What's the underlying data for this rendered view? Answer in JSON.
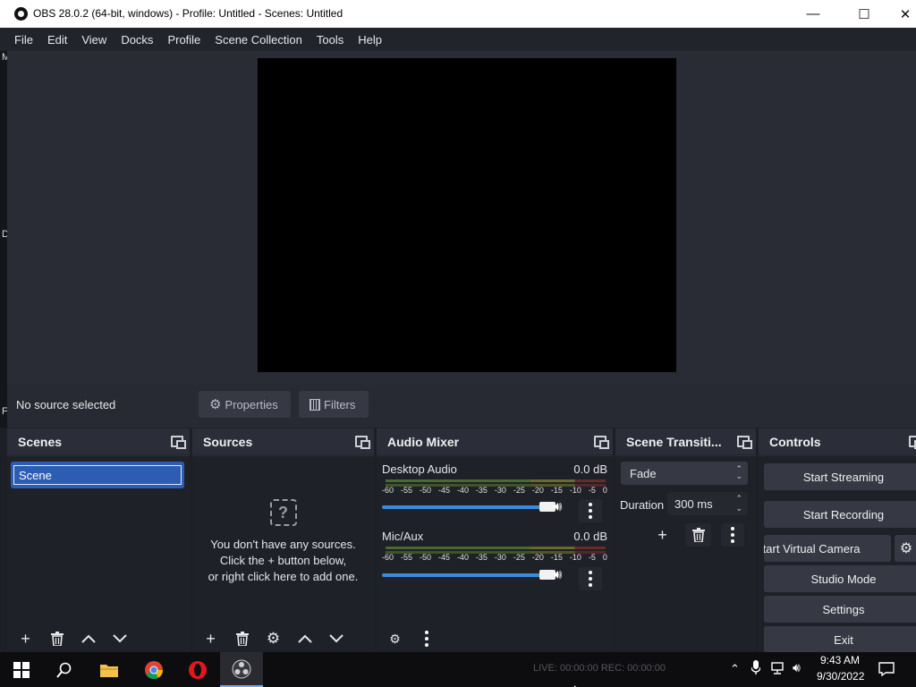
{
  "window": {
    "title": "OBS 28.0.2 (64-bit, windows) - Profile: Untitled - Scenes: Untitled",
    "minimize": "—",
    "maximize": "☐",
    "close": "✕"
  },
  "menu": [
    "File",
    "Edit",
    "View",
    "Docks",
    "Profile",
    "Scene Collection",
    "Tools",
    "Help"
  ],
  "left_strip_chars": [
    "M",
    "D",
    "F"
  ],
  "context_bar": {
    "no_source": "No source selected",
    "properties": "Properties",
    "filters": "Filters"
  },
  "scenes": {
    "title": "Scenes",
    "items": [
      "Scene"
    ]
  },
  "sources": {
    "title": "Sources",
    "empty_line1": "You don't have any sources.",
    "empty_line2": "Click the + button below,",
    "empty_line3": "or right click here to add one."
  },
  "mixer": {
    "title": "Audio Mixer",
    "ticks": [
      "-60",
      "-55",
      "-50",
      "-45",
      "-40",
      "-35",
      "-30",
      "-25",
      "-20",
      "-15",
      "-10",
      "-5",
      "0"
    ],
    "channels": [
      {
        "name": "Desktop Audio",
        "db": "0.0 dB",
        "volume": 1.0
      },
      {
        "name": "Mic/Aux",
        "db": "0.0 dB",
        "volume": 1.0
      }
    ]
  },
  "transitions": {
    "title": "Scene Transiti...",
    "selected": "Fade",
    "duration_label": "Duration",
    "duration_value": "300 ms"
  },
  "controls": {
    "title": "Controls",
    "start_streaming": "Start Streaming",
    "start_recording": "Start Recording",
    "start_virtual_camera": "Start Virtual Camera",
    "studio_mode": "Studio Mode",
    "settings": "Settings",
    "exit": "Exit"
  },
  "taskbar": {
    "tray_status": "LIVE: 00:00:00    REC: 00:00:00",
    "time": "9:43 AM",
    "date": "9/30/2022"
  }
}
